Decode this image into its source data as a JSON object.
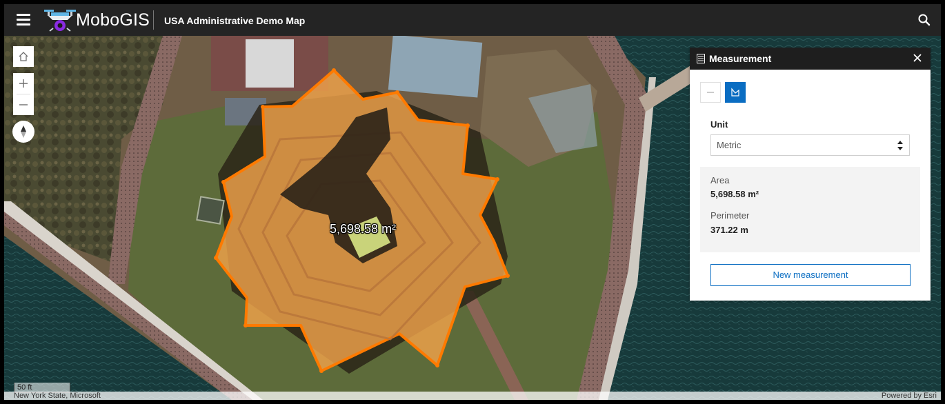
{
  "header": {
    "brand": "MoboGIS",
    "app_title": "USA Administrative Demo Map"
  },
  "map": {
    "measurement_label": "5,698.58 m²",
    "scale_text": "50 ft",
    "attribution_left": "New York State, Microsoft",
    "attribution_right": "Powered by Esri"
  },
  "panel": {
    "title": "Measurement",
    "unit_label": "Unit",
    "unit_value": "Metric",
    "area_label": "Area",
    "area_value": "5,698.58 m²",
    "perimeter_label": "Perimeter",
    "perimeter_value": "371.22 m",
    "new_measurement_label": "New measurement"
  },
  "colors": {
    "topbar": "#242424",
    "accent_blue": "#0a6dc2",
    "measure_fill": "#f0a24a",
    "measure_outline": "#ff7a00"
  },
  "icons": [
    "menu-icon",
    "drone-logo-icon",
    "search-icon",
    "home-icon",
    "plus-icon",
    "minus-icon",
    "compass-icon",
    "measurement-icon",
    "close-icon",
    "distance-tool-icon",
    "area-tool-icon",
    "select-arrows-icon"
  ]
}
